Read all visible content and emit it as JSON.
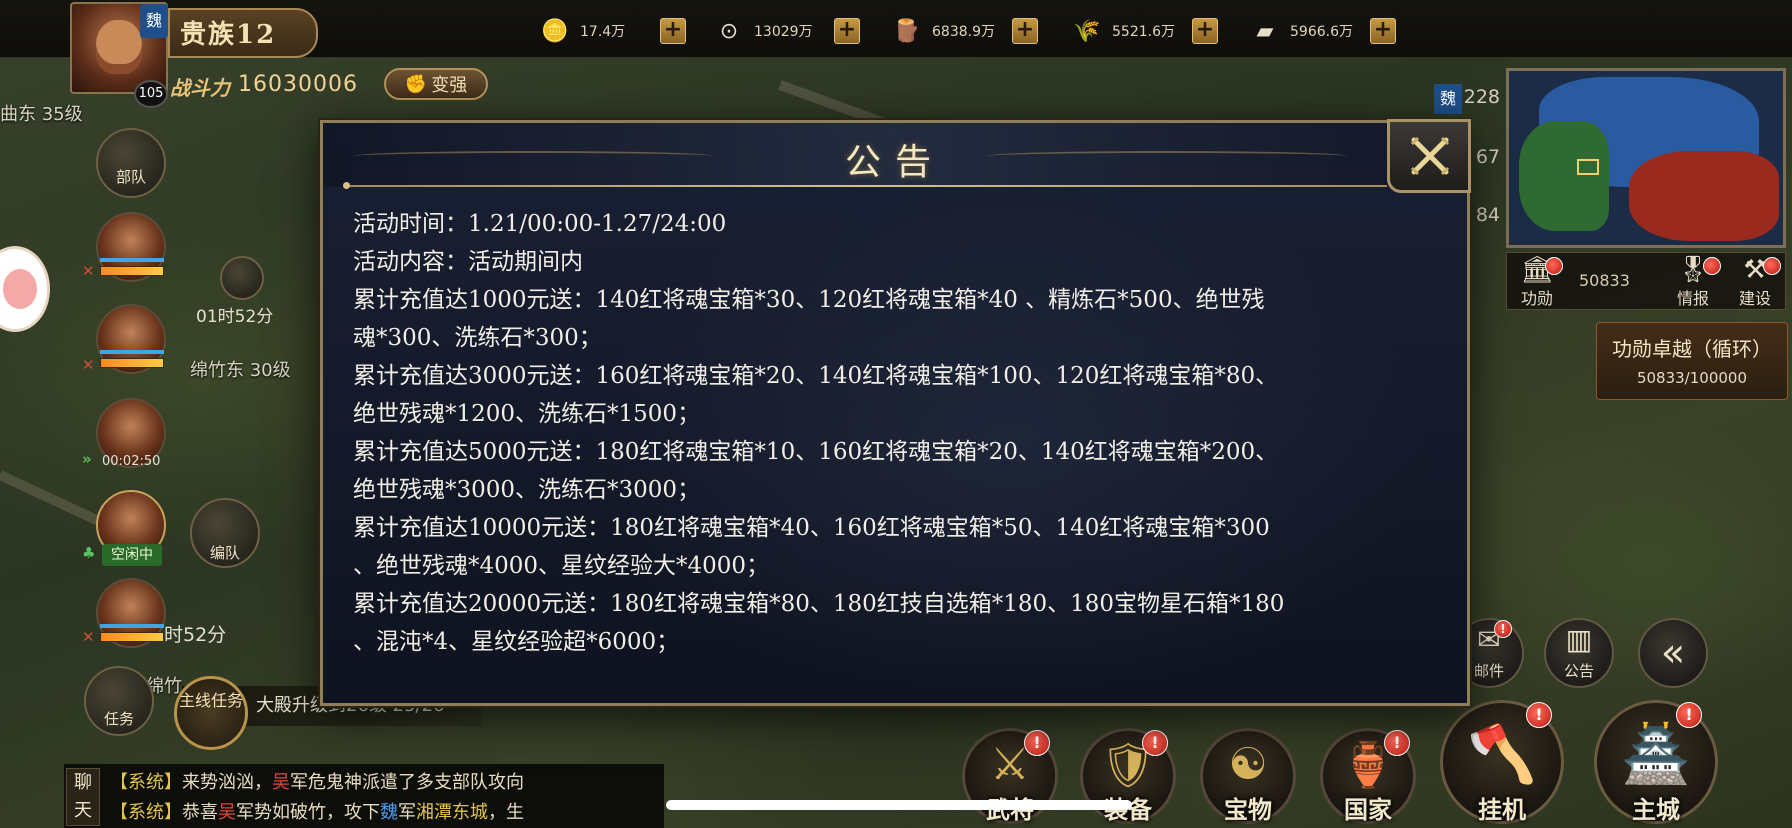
{
  "player": {
    "faction_badge": "魏",
    "level": "105",
    "noble_rank": "贵族12",
    "power_label": "战斗力",
    "power_value": "16030006",
    "strengthen_label": "变强"
  },
  "resources": [
    {
      "icon": "gold-ingot-icon",
      "glyph": "🪙",
      "value": "17.4万"
    },
    {
      "icon": "coin-icon",
      "glyph": "⊙",
      "value": "13029万"
    },
    {
      "icon": "wood-icon",
      "glyph": "🪵",
      "value": "6838.9万"
    },
    {
      "icon": "grain-icon",
      "glyph": "🌾",
      "value": "5521.6万"
    },
    {
      "icon": "iron-icon",
      "glyph": "▰",
      "value": "5966.6万"
    }
  ],
  "plus_label": "+",
  "minimap": {
    "faction_badge": "魏",
    "counters": [
      "228",
      "67",
      "84"
    ]
  },
  "stats": {
    "merit_label": "功勋",
    "merit_value": "50833",
    "intel_label": "情报",
    "build_label": "建设"
  },
  "merit_task": {
    "title": "功勋卓越（循环）",
    "progress": "50833/100000"
  },
  "left": {
    "region_top": "曲东 35级",
    "troops_label": "部队",
    "timer1": "01时52分",
    "region_mid": "绵竹东 30级",
    "timer2": "00:02:50",
    "idle_label": "空闲中",
    "formation_label": "编队",
    "timer3": "时52分",
    "region_bottom": "绵竹",
    "task_label": "任务",
    "main_quest_label": "主线任务",
    "quest_text": "大殿升级到26级 25/26"
  },
  "modal": {
    "title": "公告",
    "lines": [
      "活动时间：1.21/00:00-1.27/24:00",
      "活动内容：活动期间内",
      "累计充值达1000元送：140红将魂宝箱*30、120红将魂宝箱*40 、精炼石*500、绝世残",
      "魂*300、洗练石*300；",
      "累计充值达3000元送：160红将魂宝箱*20、140红将魂宝箱*100、120红将魂宝箱*80、",
      "绝世残魂*1200、洗练石*1500；",
      "累计充值达5000元送：180红将魂宝箱*10、160红将魂宝箱*20、140红将魂宝箱*200、",
      "绝世残魂*3000、洗练石*3000；",
      "累计充值达10000元送：180红将魂宝箱*40、160红将魂宝箱*50、140红将魂宝箱*300",
      "、绝世残魂*4000、星纹经验大*4000；",
      "累计充值达20000元送：180红将魂宝箱*80、180红技自选箱*180、180宝物星石箱*180",
      "、混沌*4、星纹经验超*6000；"
    ]
  },
  "right_buttons": {
    "mail_label": "邮件",
    "notice_label": "公告",
    "collapse_label": "«"
  },
  "bottom_menu": [
    {
      "label": "武将",
      "glyph": "⚔"
    },
    {
      "label": "装备",
      "glyph": "🛡"
    },
    {
      "label": "宝物",
      "glyph": "☯"
    },
    {
      "label": "国家",
      "glyph": "🏺"
    },
    {
      "label": "挂机",
      "glyph": "🪓"
    },
    {
      "label": "主城",
      "glyph": "🏯"
    }
  ],
  "chat": {
    "tab_label": "聊天",
    "line1": {
      "sys": "【系统】",
      "a": "来势汹汹，",
      "red": "吴",
      "b": "军危鬼神派遣了多支部队攻向"
    },
    "line2": {
      "sys": "【系统】",
      "a": "恭喜",
      "red": "吴",
      "b": "军势如破竹，攻下",
      "blue": "魏",
      "c": "军",
      "gold": "湘潭东城",
      "d": "，生"
    }
  }
}
